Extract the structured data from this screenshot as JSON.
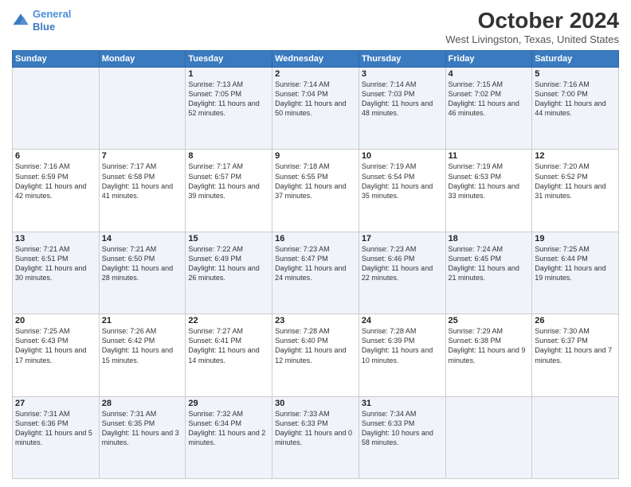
{
  "header": {
    "logo_line1": "General",
    "logo_line2": "Blue",
    "month_title": "October 2024",
    "location": "West Livingston, Texas, United States"
  },
  "days_of_week": [
    "Sunday",
    "Monday",
    "Tuesday",
    "Wednesday",
    "Thursday",
    "Friday",
    "Saturday"
  ],
  "weeks": [
    [
      {
        "day": "",
        "info": ""
      },
      {
        "day": "",
        "info": ""
      },
      {
        "day": "1",
        "info": "Sunrise: 7:13 AM\nSunset: 7:05 PM\nDaylight: 11 hours and 52 minutes."
      },
      {
        "day": "2",
        "info": "Sunrise: 7:14 AM\nSunset: 7:04 PM\nDaylight: 11 hours and 50 minutes."
      },
      {
        "day": "3",
        "info": "Sunrise: 7:14 AM\nSunset: 7:03 PM\nDaylight: 11 hours and 48 minutes."
      },
      {
        "day": "4",
        "info": "Sunrise: 7:15 AM\nSunset: 7:02 PM\nDaylight: 11 hours and 46 minutes."
      },
      {
        "day": "5",
        "info": "Sunrise: 7:16 AM\nSunset: 7:00 PM\nDaylight: 11 hours and 44 minutes."
      }
    ],
    [
      {
        "day": "6",
        "info": "Sunrise: 7:16 AM\nSunset: 6:59 PM\nDaylight: 11 hours and 42 minutes."
      },
      {
        "day": "7",
        "info": "Sunrise: 7:17 AM\nSunset: 6:58 PM\nDaylight: 11 hours and 41 minutes."
      },
      {
        "day": "8",
        "info": "Sunrise: 7:17 AM\nSunset: 6:57 PM\nDaylight: 11 hours and 39 minutes."
      },
      {
        "day": "9",
        "info": "Sunrise: 7:18 AM\nSunset: 6:55 PM\nDaylight: 11 hours and 37 minutes."
      },
      {
        "day": "10",
        "info": "Sunrise: 7:19 AM\nSunset: 6:54 PM\nDaylight: 11 hours and 35 minutes."
      },
      {
        "day": "11",
        "info": "Sunrise: 7:19 AM\nSunset: 6:53 PM\nDaylight: 11 hours and 33 minutes."
      },
      {
        "day": "12",
        "info": "Sunrise: 7:20 AM\nSunset: 6:52 PM\nDaylight: 11 hours and 31 minutes."
      }
    ],
    [
      {
        "day": "13",
        "info": "Sunrise: 7:21 AM\nSunset: 6:51 PM\nDaylight: 11 hours and 30 minutes."
      },
      {
        "day": "14",
        "info": "Sunrise: 7:21 AM\nSunset: 6:50 PM\nDaylight: 11 hours and 28 minutes."
      },
      {
        "day": "15",
        "info": "Sunrise: 7:22 AM\nSunset: 6:49 PM\nDaylight: 11 hours and 26 minutes."
      },
      {
        "day": "16",
        "info": "Sunrise: 7:23 AM\nSunset: 6:47 PM\nDaylight: 11 hours and 24 minutes."
      },
      {
        "day": "17",
        "info": "Sunrise: 7:23 AM\nSunset: 6:46 PM\nDaylight: 11 hours and 22 minutes."
      },
      {
        "day": "18",
        "info": "Sunrise: 7:24 AM\nSunset: 6:45 PM\nDaylight: 11 hours and 21 minutes."
      },
      {
        "day": "19",
        "info": "Sunrise: 7:25 AM\nSunset: 6:44 PM\nDaylight: 11 hours and 19 minutes."
      }
    ],
    [
      {
        "day": "20",
        "info": "Sunrise: 7:25 AM\nSunset: 6:43 PM\nDaylight: 11 hours and 17 minutes."
      },
      {
        "day": "21",
        "info": "Sunrise: 7:26 AM\nSunset: 6:42 PM\nDaylight: 11 hours and 15 minutes."
      },
      {
        "day": "22",
        "info": "Sunrise: 7:27 AM\nSunset: 6:41 PM\nDaylight: 11 hours and 14 minutes."
      },
      {
        "day": "23",
        "info": "Sunrise: 7:28 AM\nSunset: 6:40 PM\nDaylight: 11 hours and 12 minutes."
      },
      {
        "day": "24",
        "info": "Sunrise: 7:28 AM\nSunset: 6:39 PM\nDaylight: 11 hours and 10 minutes."
      },
      {
        "day": "25",
        "info": "Sunrise: 7:29 AM\nSunset: 6:38 PM\nDaylight: 11 hours and 9 minutes."
      },
      {
        "day": "26",
        "info": "Sunrise: 7:30 AM\nSunset: 6:37 PM\nDaylight: 11 hours and 7 minutes."
      }
    ],
    [
      {
        "day": "27",
        "info": "Sunrise: 7:31 AM\nSunset: 6:36 PM\nDaylight: 11 hours and 5 minutes."
      },
      {
        "day": "28",
        "info": "Sunrise: 7:31 AM\nSunset: 6:35 PM\nDaylight: 11 hours and 3 minutes."
      },
      {
        "day": "29",
        "info": "Sunrise: 7:32 AM\nSunset: 6:34 PM\nDaylight: 11 hours and 2 minutes."
      },
      {
        "day": "30",
        "info": "Sunrise: 7:33 AM\nSunset: 6:33 PM\nDaylight: 11 hours and 0 minutes."
      },
      {
        "day": "31",
        "info": "Sunrise: 7:34 AM\nSunset: 6:33 PM\nDaylight: 10 hours and 58 minutes."
      },
      {
        "day": "",
        "info": ""
      },
      {
        "day": "",
        "info": ""
      }
    ]
  ]
}
